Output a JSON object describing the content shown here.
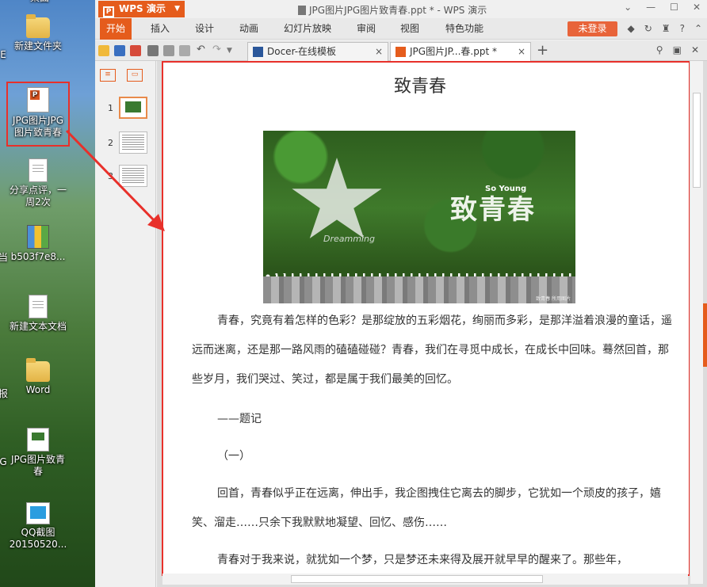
{
  "desktop": {
    "icons": [
      {
        "label": "桌面"
      },
      {
        "label": "新建文件夹"
      },
      {
        "label": "JPG图片JPG图片致青春"
      },
      {
        "label": "分享点评，一周2次"
      },
      {
        "label": "b503f7e8..."
      },
      {
        "label": "新建文本文档"
      },
      {
        "label": "Word"
      },
      {
        "label": "JPG图片致青春"
      },
      {
        "label": "QQ截图20150520..."
      }
    ],
    "edge_labels": [
      "E",
      "当",
      "报",
      "G"
    ]
  },
  "app": {
    "name": "WPS 演示",
    "window_title": "JPG图片JPG图片致青春.ppt * - WPS 演示",
    "menu": [
      "开始",
      "插入",
      "设计",
      "动画",
      "幻灯片放映",
      "审阅",
      "视图",
      "特色功能"
    ],
    "active_menu_index": 0,
    "login_label": "未登录",
    "tabs": [
      {
        "label": "Docer-在线模板",
        "close": "×"
      },
      {
        "label": "JPG图片JP...春.ppt *",
        "close": "×"
      }
    ],
    "tab_add": "+"
  },
  "thumbs": [
    {
      "num": "1"
    },
    {
      "num": "2"
    },
    {
      "num": "3"
    }
  ],
  "slide": {
    "title": "致青春",
    "hero": {
      "big_text": "致青春",
      "sub_text": "So Young",
      "script_text": "Dreamming",
      "credit": "致青春 所用图片"
    },
    "paragraphs": [
      "青春，究竟有着怎样的色彩？是那绽放的五彩烟花，绚丽而多彩，是那洋溢着浪漫的童话，遥远而迷离，还是那一路风雨的磕磕碰碰？青春，我们在寻觅中成长，在成长中回味。蓦然回首，那些岁月，我们哭过、笑过，都是属于我们最美的回忆。",
      "——题记",
      "（一）",
      "回首，青春似乎正在远离，伸出手，我企图拽住它离去的脚步，它犹如一个顽皮的孩子，嬉笑、溜走……只余下我默默地凝望、回忆、感伤……",
      "青春对于我来说，就犹如一个梦，只是梦还未来得及展开就早早的醒来了。那些年，"
    ]
  },
  "colors": {
    "accent": "#e55c1c",
    "annotation": "#e8302a"
  }
}
